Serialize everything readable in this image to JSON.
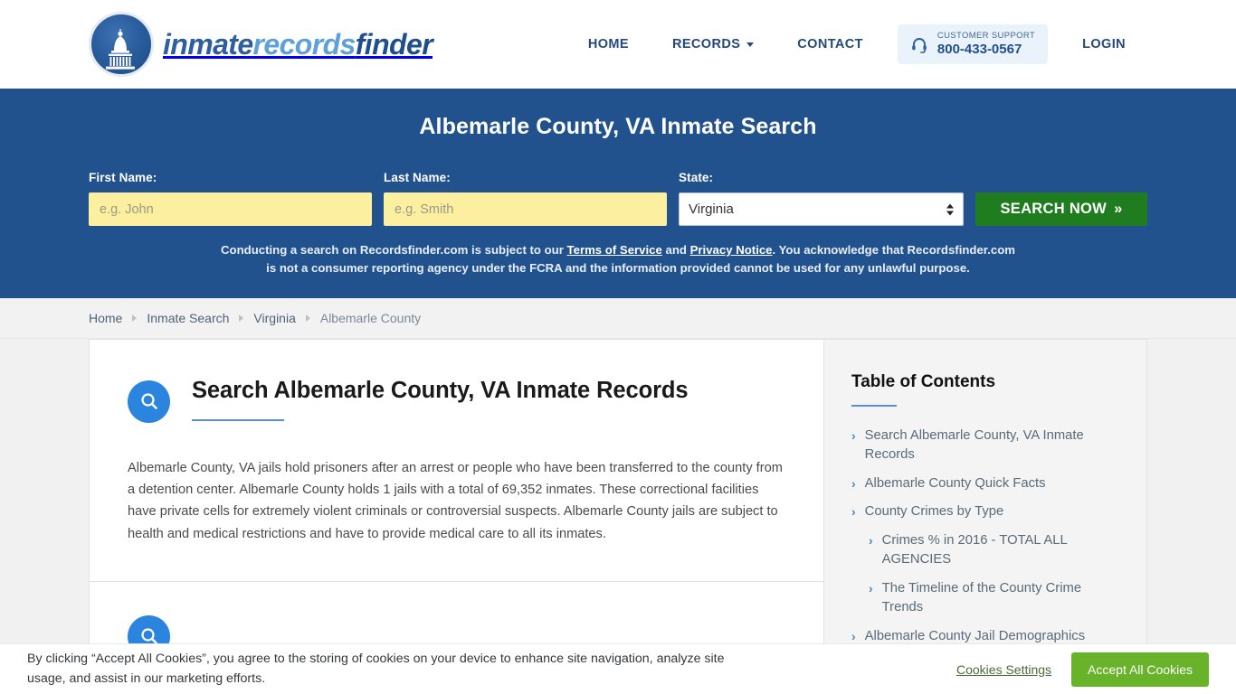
{
  "header": {
    "brand": {
      "seal_icon": "capitol-dome-icon",
      "part1": "inmate",
      "part2": "records",
      "part3": "finder"
    },
    "nav": [
      {
        "label": "HOME",
        "has_caret": false
      },
      {
        "label": "RECORDS",
        "has_caret": true
      },
      {
        "label": "CONTACT",
        "has_caret": false
      }
    ],
    "support": {
      "icon": "headset-icon",
      "label": "CUSTOMER SUPPORT",
      "phone": "800-433-0567"
    },
    "login_label": "LOGIN"
  },
  "search_band": {
    "title": "Albemarle County, VA Inmate Search",
    "first_name": {
      "label": "First Name:",
      "value": "",
      "placeholder": "e.g. John"
    },
    "last_name": {
      "label": "Last Name:",
      "value": "",
      "placeholder": "e.g. Smith"
    },
    "state": {
      "label": "State:",
      "value": "Virginia"
    },
    "search_button": "SEARCH NOW",
    "search_button_chevrons": "»",
    "disclaimer": {
      "part1": "Conducting a search on Recordsfinder.com is subject to our ",
      "link1": "Terms of Service",
      "part2": " and ",
      "link2": "Privacy Notice",
      "part3": ". You acknowledge that Recordsfinder.com is not a consumer reporting agency under the FCRA and the information provided cannot be used for any unlawful purpose."
    }
  },
  "breadcrumb": [
    {
      "label": "Home",
      "current": false
    },
    {
      "label": "Inmate Search",
      "current": false
    },
    {
      "label": "Virginia",
      "current": false
    },
    {
      "label": "Albemarle County",
      "current": true
    }
  ],
  "main": {
    "icon": "magnifier-icon",
    "title": "Search Albemarle County, VA Inmate Records",
    "paragraph": "Albemarle County, VA jails hold prisoners after an arrest or people who have been transferred to the county from a detention center. Albemarle County holds 1 jails with a total of 69,352 inmates. These correctional facilities have private cells for extremely violent criminals or controversial suspects. Albemarle County jails are subject to health and medical restrictions and have to provide medical care to all its inmates.",
    "next_section_icon": "magnifier-icon"
  },
  "toc": {
    "title": "Table of Contents",
    "items": [
      {
        "label": "Search Albemarle County, VA Inmate Records",
        "sub": false
      },
      {
        "label": "Albemarle County Quick Facts",
        "sub": false
      },
      {
        "label": "County Crimes by Type",
        "sub": false
      },
      {
        "label": "Crimes % in 2016 - TOTAL ALL AGENCIES",
        "sub": true
      },
      {
        "label": "The Timeline of the County Crime Trends",
        "sub": true
      },
      {
        "label": "Albemarle County Jail Demographics",
        "sub": false
      }
    ],
    "chevron": "›"
  },
  "cookie_banner": {
    "text": "By clicking “Accept All Cookies”, you agree to the storing of cookies on your device to enhance site navigation, analyze site usage, and assist in our marketing efforts.",
    "settings_label": "Cookies Settings",
    "accept_label": "Accept All Cookies"
  },
  "colors": {
    "band_blue": "#22528e",
    "brand_blue": "#1f4f8b",
    "accent_blue": "#2b84de",
    "input_yellow": "#fcef9f",
    "search_green": "#1f7d1f",
    "cookie_green": "#68b32a"
  }
}
